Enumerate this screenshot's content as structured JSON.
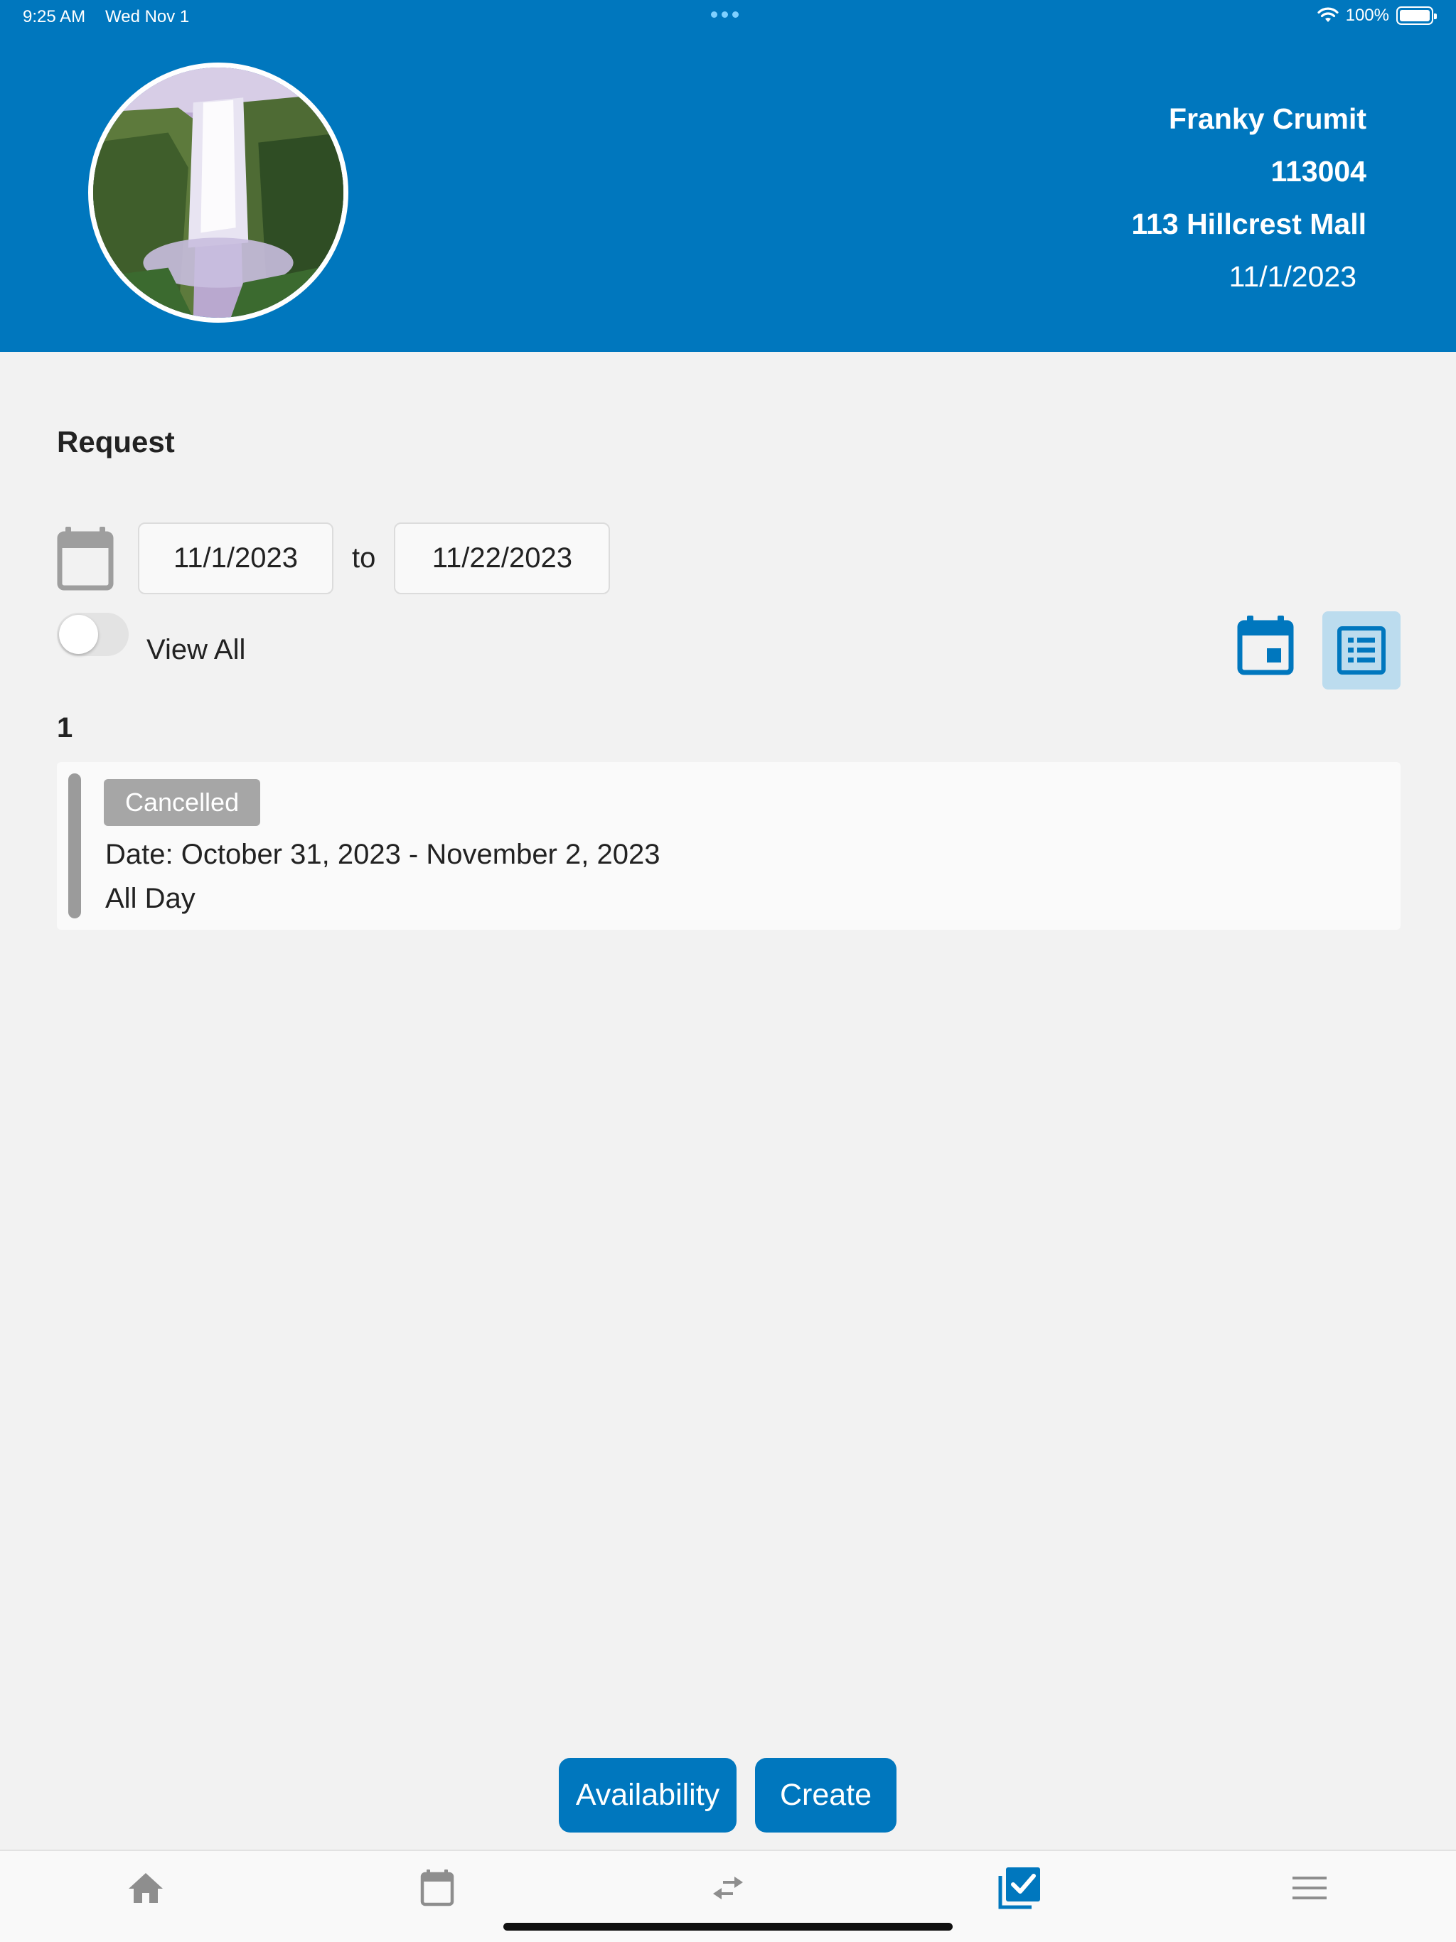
{
  "status_bar": {
    "time": "9:25 AM",
    "date": "Wed Nov 1",
    "battery": "100%"
  },
  "profile": {
    "name": "Franky Crumit",
    "employee_id": "113004",
    "store": "113 Hillcrest Mall",
    "date": "11/1/2023"
  },
  "request": {
    "title": "Request",
    "date_from": "11/1/2023",
    "to_label": "to",
    "date_to": "11/22/2023",
    "view_all_label": "View All",
    "view_all_on": false,
    "count": "1",
    "items": [
      {
        "status": "Cancelled",
        "date_text": "Date: October 31, 2023 - November 2, 2023",
        "time_text": "All Day"
      }
    ]
  },
  "actions": {
    "availability_label": "Availability",
    "create_label": "Create"
  },
  "tabs": [
    {
      "icon": "home-icon",
      "active": false
    },
    {
      "icon": "calendar-icon",
      "active": false
    },
    {
      "icon": "swap-icon",
      "active": false
    },
    {
      "icon": "checkbox-icon",
      "active": true
    },
    {
      "icon": "menu-icon",
      "active": false
    }
  ],
  "colors": {
    "brand": "#0077be",
    "status_cancelled": "#a6a6a6",
    "background": "#f2f2f2"
  }
}
